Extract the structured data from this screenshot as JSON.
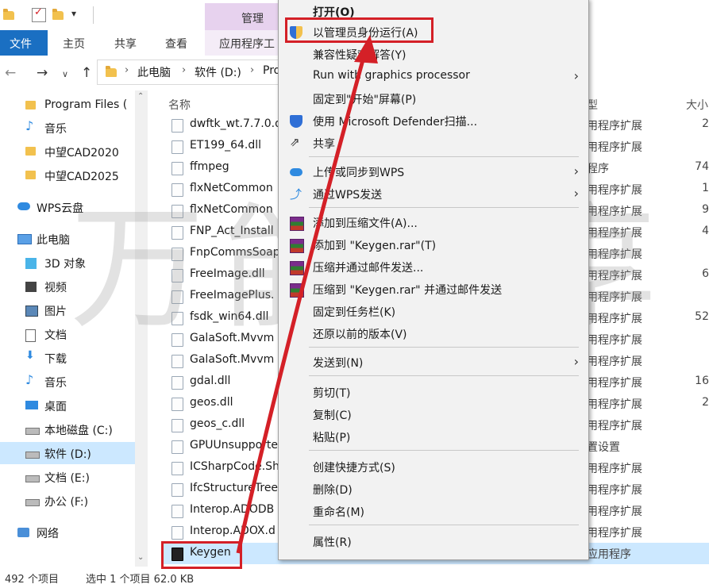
{
  "ribbon": {
    "manage": "管理",
    "tabs": [
      "文件",
      "主页",
      "共享",
      "查看",
      "应用程序工"
    ]
  },
  "address": {
    "segments": [
      "此电脑",
      "软件 (D:)",
      "Pro"
    ]
  },
  "nav": {
    "items": [
      {
        "label": "Program Files (",
        "icon": "folder-icon"
      },
      {
        "label": "音乐",
        "icon": "music-icon"
      },
      {
        "label": "中望CAD2020",
        "icon": "folder-icon"
      },
      {
        "label": "中望CAD2025",
        "icon": "folder-icon"
      },
      {
        "label": "WPS云盘",
        "icon": "cloud-icon"
      },
      {
        "label": "此电脑",
        "icon": "computer-icon"
      },
      {
        "label": "3D 对象",
        "icon": "cube-icon"
      },
      {
        "label": "视频",
        "icon": "video-icon"
      },
      {
        "label": "图片",
        "icon": "picture-icon"
      },
      {
        "label": "文档",
        "icon": "document-icon"
      },
      {
        "label": "下载",
        "icon": "download-icon"
      },
      {
        "label": "音乐",
        "icon": "music-icon"
      },
      {
        "label": "桌面",
        "icon": "desktop-icon"
      },
      {
        "label": "本地磁盘 (C:)",
        "icon": "drive-icon"
      },
      {
        "label": "软件 (D:)",
        "icon": "drive-icon"
      },
      {
        "label": "文档 (E:)",
        "icon": "drive-icon"
      },
      {
        "label": "办公 (F:)",
        "icon": "drive-icon"
      },
      {
        "label": "网络",
        "icon": "network-icon"
      }
    ]
  },
  "files": {
    "header_name": "名称",
    "header_type": "型",
    "header_size": "大小",
    "rows": [
      {
        "name": "dwftk_wt.7.7.0.d",
        "type": "用程序扩展",
        "size": "2"
      },
      {
        "name": "ET199_64.dll",
        "type": "用程序扩展",
        "size": ""
      },
      {
        "name": "ffmpeg",
        "type": "程序",
        "size": "74"
      },
      {
        "name": "flxNetCommon",
        "type": "用程序扩展",
        "size": "1"
      },
      {
        "name": "flxNetCommon",
        "type": "用程序扩展",
        "size": "9"
      },
      {
        "name": "FNP_Act_Install",
        "type": "用程序扩展",
        "size": "4"
      },
      {
        "name": "FnpCommsSoap",
        "type": "用程序扩展",
        "size": ""
      },
      {
        "name": "FreeImage.dll",
        "type": "用程序扩展",
        "size": "6"
      },
      {
        "name": "FreeImagePlus.",
        "type": "用程序扩展",
        "size": ""
      },
      {
        "name": "fsdk_win64.dll",
        "type": "用程序扩展",
        "size": "52"
      },
      {
        "name": "GalaSoft.Mvvm",
        "type": "用程序扩展",
        "size": ""
      },
      {
        "name": "GalaSoft.Mvvm",
        "type": "用程序扩展",
        "size": ""
      },
      {
        "name": "gdal.dll",
        "type": "用程序扩展",
        "size": "16"
      },
      {
        "name": "geos.dll",
        "type": "用程序扩展",
        "size": "2"
      },
      {
        "name": "geos_c.dll",
        "type": "用程序扩展",
        "size": ""
      },
      {
        "name": "GPUUnsupporte",
        "type": "置设置",
        "size": ""
      },
      {
        "name": "ICSharpCode.Sh",
        "type": "用程序扩展",
        "size": ""
      },
      {
        "name": "IfcStructureTree",
        "type": "用程序扩展",
        "size": ""
      },
      {
        "name": "Interop.ADODB",
        "type": "用程序扩展",
        "size": ""
      },
      {
        "name": "Interop.ADOX.d",
        "type": "用程序扩展",
        "size": ""
      },
      {
        "name": "Keygen",
        "type": "应用程序",
        "size": ""
      }
    ]
  },
  "status": {
    "count": "492 个项目",
    "selected": "选中 1 个项目  62.0 KB"
  },
  "context_menu": {
    "items": [
      {
        "label": "打开(O)",
        "bold": true
      },
      {
        "label": "以管理员身份运行(A)",
        "icon": "shield-uac-icon"
      },
      {
        "label": "兼容性疑难解答(Y)"
      },
      {
        "label": "Run with graphics processor",
        "submenu": true
      },
      {
        "label": "固定到\"开始\"屏幕(P)"
      },
      {
        "label": "使用 Microsoft Defender扫描...",
        "icon": "defender-icon"
      },
      {
        "label": "共享",
        "icon": "share-icon"
      },
      {
        "label": "上传或同步到WPS",
        "icon": "wps-cloud-icon",
        "submenu": true
      },
      {
        "label": "通过WPS发送",
        "icon": "wps-send-icon",
        "submenu": true
      },
      {
        "label": "添加到压缩文件(A)...",
        "icon": "winrar-icon"
      },
      {
        "label": "添加到 \"Keygen.rar\"(T)",
        "icon": "winrar-icon"
      },
      {
        "label": "压缩并通过邮件发送...",
        "icon": "winrar-icon"
      },
      {
        "label": "压缩到 \"Keygen.rar\" 并通过邮件发送",
        "icon": "winrar-icon"
      },
      {
        "label": "固定到任务栏(K)"
      },
      {
        "label": "还原以前的版本(V)"
      },
      {
        "label": "发送到(N)",
        "submenu": true
      },
      {
        "label": "剪切(T)"
      },
      {
        "label": "复制(C)"
      },
      {
        "label": "粘贴(P)"
      },
      {
        "label": "创建快捷方式(S)"
      },
      {
        "label": "删除(D)"
      },
      {
        "label": "重命名(M)"
      },
      {
        "label": "属性(R)"
      }
    ]
  },
  "watermark": "万能共享",
  "colors": {
    "accent": "#1a6fc2",
    "selection": "#cce8ff",
    "annotation": "#d42027",
    "manage_tab": "#e7d2ee"
  }
}
